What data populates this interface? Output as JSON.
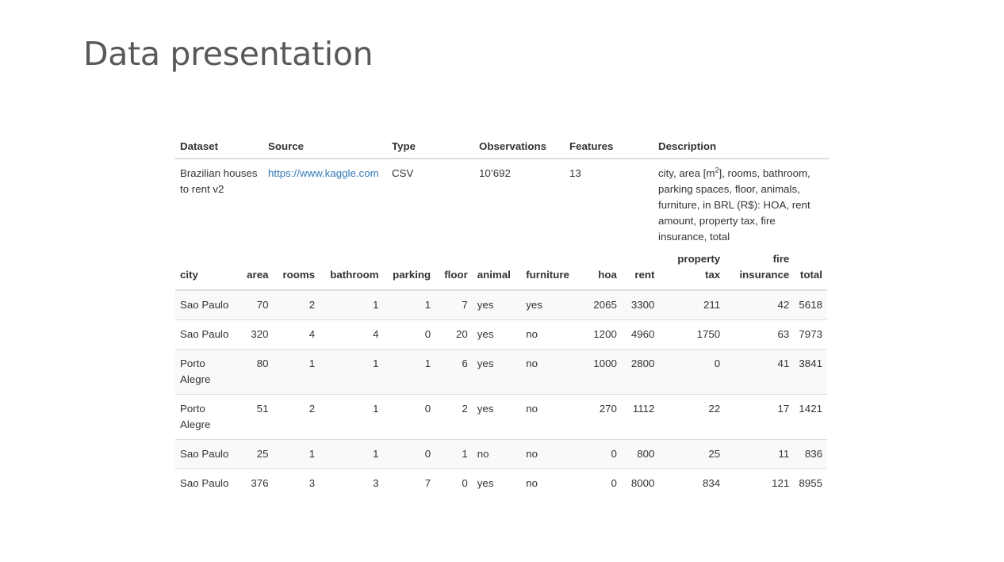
{
  "slide": {
    "title": "Data presentation"
  },
  "dataset_table": {
    "headers": [
      "Dataset",
      "Source",
      "Type",
      "Observations",
      "Features",
      "Description"
    ],
    "row": {
      "dataset": "Brazilian houses to rent v2",
      "source": "https://www.kaggle.com",
      "type": "CSV",
      "observations": "10’692",
      "features": "13",
      "description_before_sup": "city, area [m",
      "description_sup": "2",
      "description_after_sup": "], rooms, bathroom, parking spaces, floor, animals, furniture, in BRL (R$): HOA, rent amount, property tax, fire insurance, total"
    }
  },
  "data_table": {
    "headers": [
      {
        "line1": "",
        "line2": "city"
      },
      {
        "line1": "",
        "line2": "area"
      },
      {
        "line1": "",
        "line2": "rooms"
      },
      {
        "line1": "",
        "line2": "bathroom"
      },
      {
        "line1": "",
        "line2": "parking"
      },
      {
        "line1": "",
        "line2": "floor"
      },
      {
        "line1": "",
        "line2": "animal"
      },
      {
        "line1": "",
        "line2": "furniture"
      },
      {
        "line1": "",
        "line2": "hoa"
      },
      {
        "line1": "",
        "line2": "rent"
      },
      {
        "line1": "property",
        "line2": "tax"
      },
      {
        "line1": "fire",
        "line2": "insurance"
      },
      {
        "line1": "",
        "line2": "total"
      }
    ],
    "rows": [
      [
        "Sao Paulo",
        "70",
        "2",
        "1",
        "1",
        "7",
        "yes",
        "yes",
        "2065",
        "3300",
        "211",
        "42",
        "5618"
      ],
      [
        "Sao Paulo",
        "320",
        "4",
        "4",
        "0",
        "20",
        "yes",
        "no",
        "1200",
        "4960",
        "1750",
        "63",
        "7973"
      ],
      [
        "Porto Alegre",
        "80",
        "1",
        "1",
        "1",
        "6",
        "yes",
        "no",
        "1000",
        "2800",
        "0",
        "41",
        "3841"
      ],
      [
        "Porto Alegre",
        "51",
        "2",
        "1",
        "0",
        "2",
        "yes",
        "no",
        "270",
        "1112",
        "22",
        "17",
        "1421"
      ],
      [
        "Sao Paulo",
        "25",
        "1",
        "1",
        "0",
        "1",
        "no",
        "no",
        "0",
        "800",
        "25",
        "11",
        "836"
      ],
      [
        "Sao Paulo",
        "376",
        "3",
        "3",
        "7",
        "0",
        "yes",
        "no",
        "0",
        "8000",
        "834",
        "121",
        "8955"
      ]
    ]
  }
}
